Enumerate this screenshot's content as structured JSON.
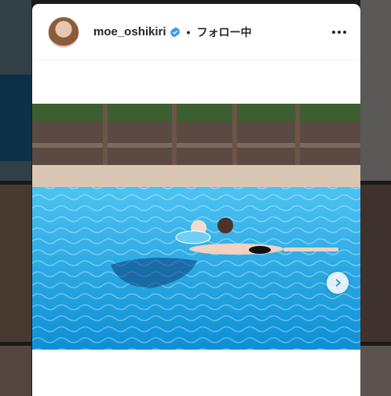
{
  "post": {
    "username": "moe_oshikiri",
    "separator": "•",
    "follow_status": "フォロー中"
  },
  "icons": {
    "verified": "verified-badge-icon",
    "more": "more-options-icon",
    "next": "chevron-right-icon"
  },
  "colors": {
    "verified_blue": "#3897f0",
    "text": "#262626",
    "pool_water": "#1aa3e6"
  }
}
